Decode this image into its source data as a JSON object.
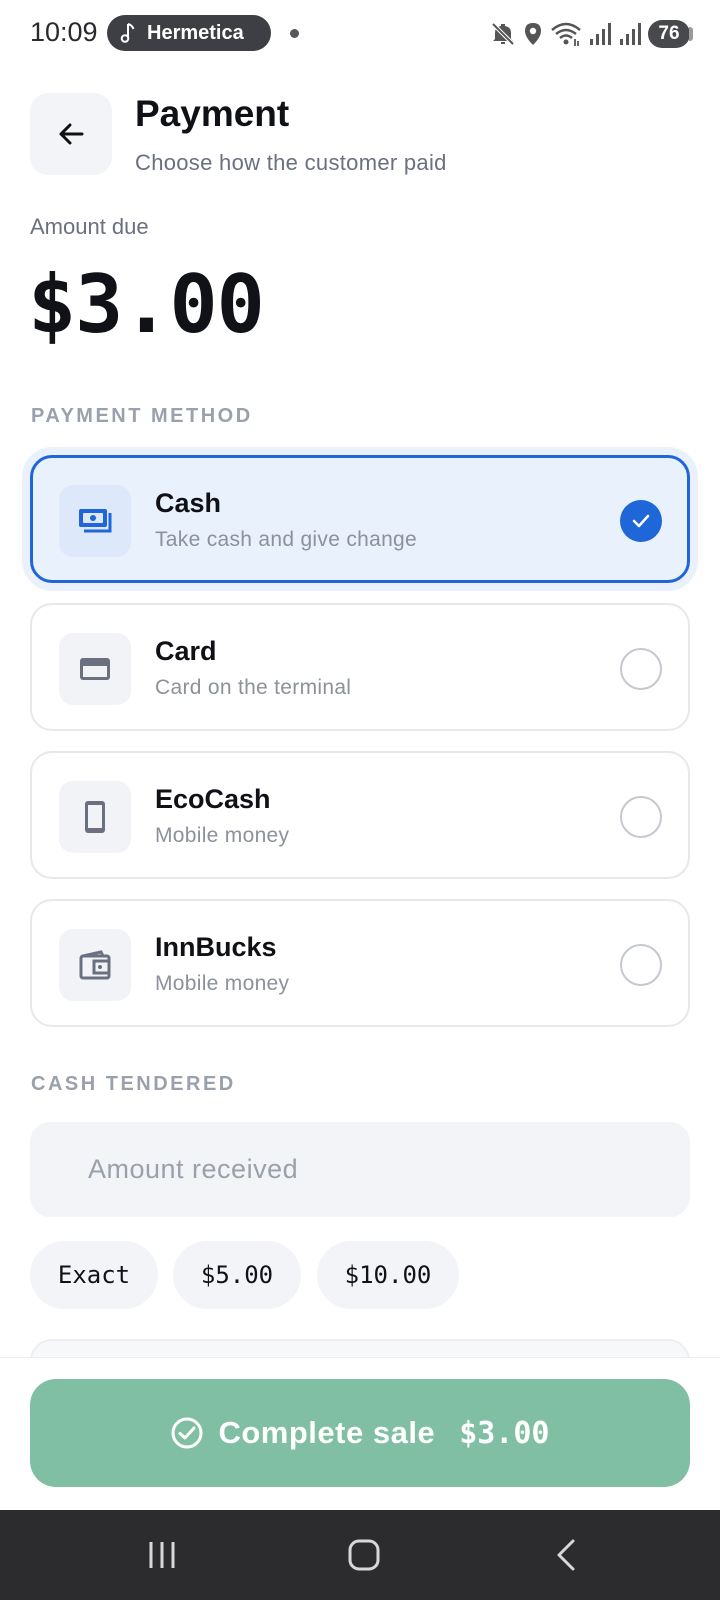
{
  "status_bar": {
    "time": "10:09",
    "media_app": "Hermetica",
    "battery": "76",
    "icons": [
      "mute-icon",
      "location-icon",
      "wifi-icon",
      "signal-icon",
      "signal-icon"
    ]
  },
  "header": {
    "title": "Payment",
    "subtitle": "Choose how the customer paid",
    "back_icon": "arrow-left-icon"
  },
  "amount": {
    "label": "Amount due",
    "value": "$3.00"
  },
  "payment_method": {
    "section_label": "PAYMENT METHOD",
    "selected": "cash",
    "options": [
      {
        "id": "cash",
        "name": "Cash",
        "description": "Take cash and give change",
        "icon": "cash-icon",
        "selected": true
      },
      {
        "id": "card",
        "name": "Card",
        "description": "Card on the terminal",
        "icon": "credit-card-icon",
        "selected": false
      },
      {
        "id": "ecocash",
        "name": "EcoCash",
        "description": "Mobile money",
        "icon": "phone-icon",
        "selected": false
      },
      {
        "id": "innbucks",
        "name": "InnBucks",
        "description": "Mobile money",
        "icon": "wallet-icon",
        "selected": false
      }
    ]
  },
  "cash_tendered": {
    "section_label": "CASH TENDERED",
    "input_placeholder": "Amount received",
    "input_value": "",
    "quick_amounts": [
      "Exact",
      "$5.00",
      "$10.00"
    ]
  },
  "complete": {
    "label": "Complete sale",
    "amount": "$3.00"
  },
  "colors": {
    "accent": "#1f66d8",
    "selected_bg": "#e9f1fd",
    "complete_button": "#80bfa4",
    "muted_text": "#8c919c"
  }
}
